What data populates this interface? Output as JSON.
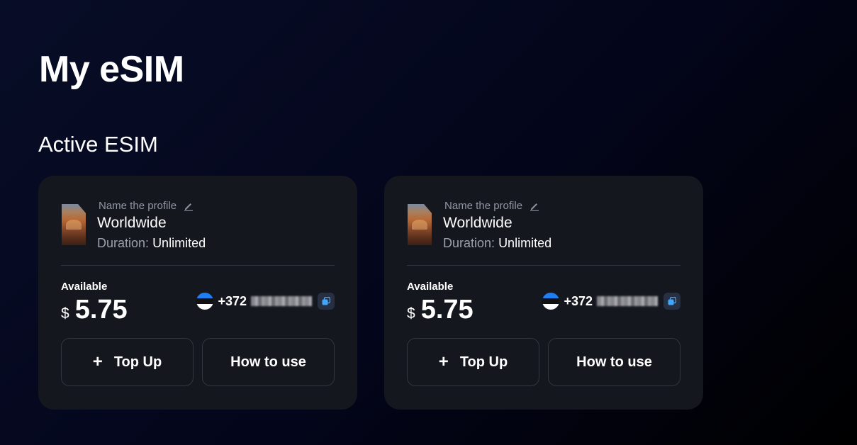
{
  "page": {
    "title": "My eSIM",
    "section_title": "Active ESIM"
  },
  "cards": [
    {
      "profile_label": "Name the profile",
      "plan_name": "Worldwide",
      "duration_label": "Duration:",
      "duration_value": "Unlimited",
      "available_label": "Available",
      "currency": "$",
      "amount": "5.75",
      "phone_prefix": "+372",
      "flag_icon": "estonia-flag-icon",
      "topup_plus": "+",
      "topup_label": "Top Up",
      "howto_label": "How to use"
    },
    {
      "profile_label": "Name the profile",
      "plan_name": "Worldwide",
      "duration_label": "Duration:",
      "duration_value": "Unlimited",
      "available_label": "Available",
      "currency": "$",
      "amount": "5.75",
      "phone_prefix": "+372",
      "flag_icon": "estonia-flag-icon",
      "topup_plus": "+",
      "topup_label": "Top Up",
      "howto_label": "How to use"
    }
  ],
  "colors": {
    "card_bg": "#15171f",
    "accent_copy": "#3ea6ff"
  }
}
